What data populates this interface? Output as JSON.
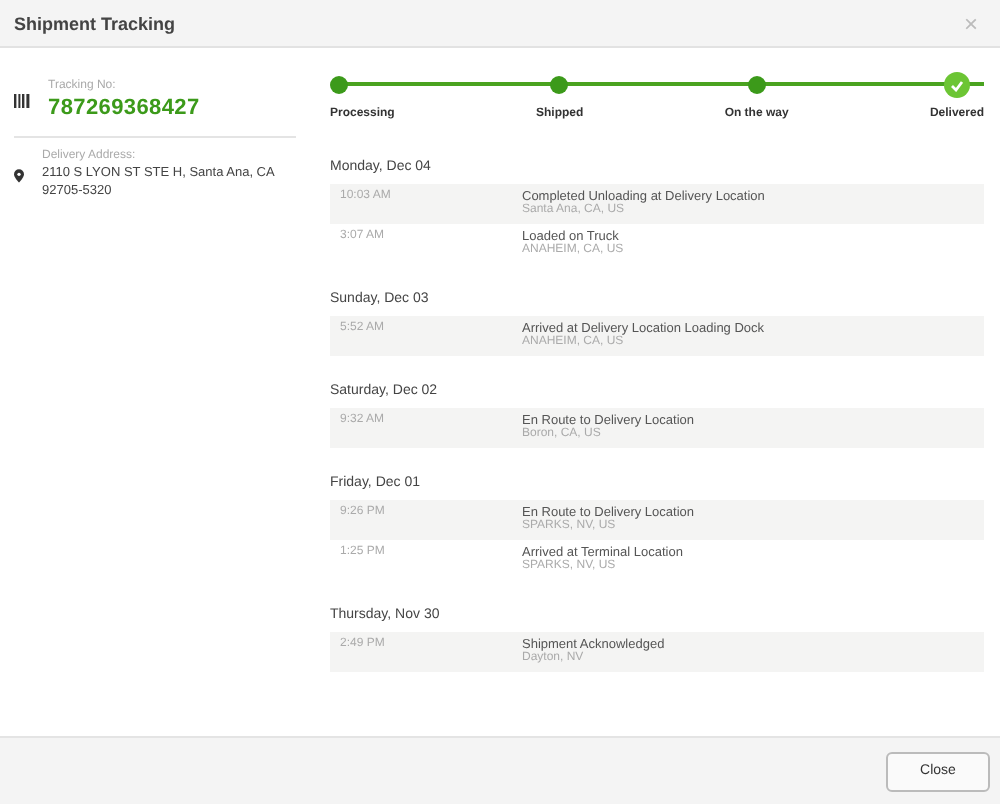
{
  "window": {
    "title": "Shipment Tracking",
    "close_glyph": "×"
  },
  "tracking": {
    "label": "Tracking No:",
    "number": "787269368427"
  },
  "delivery": {
    "label": "Delivery Address:",
    "address": "2110 S LYON ST STE H, Santa Ana, CA 92705-5320"
  },
  "steps": [
    {
      "label": "Processing",
      "done": true,
      "current": false
    },
    {
      "label": "Shipped",
      "done": true,
      "current": false
    },
    {
      "label": "On the way",
      "done": true,
      "current": false
    },
    {
      "label": "Delivered",
      "done": true,
      "current": true
    }
  ],
  "days": [
    {
      "date": "Monday, Dec 04",
      "events": [
        {
          "time": "10:03 AM",
          "title": "Completed Unloading at Delivery Location",
          "place": "Santa Ana, CA, US"
        },
        {
          "time": "3:07 AM",
          "title": "Loaded on Truck",
          "place": "ANAHEIM, CA, US"
        }
      ]
    },
    {
      "date": "Sunday, Dec 03",
      "events": [
        {
          "time": "5:52 AM",
          "title": "Arrived at Delivery Location Loading Dock",
          "place": "ANAHEIM, CA, US"
        }
      ]
    },
    {
      "date": "Saturday, Dec 02",
      "events": [
        {
          "time": "9:32 AM",
          "title": "En Route to Delivery Location",
          "place": "Boron, CA, US"
        }
      ]
    },
    {
      "date": "Friday, Dec 01",
      "events": [
        {
          "time": "9:26 PM",
          "title": "En Route to Delivery Location",
          "place": "SPARKS, NV, US"
        },
        {
          "time": "1:25 PM",
          "title": "Arrived at Terminal Location",
          "place": "SPARKS, NV, US"
        }
      ]
    },
    {
      "date": "Thursday, Nov 30",
      "events": [
        {
          "time": "2:49 PM",
          "title": "Shipment Acknowledged",
          "place": "Dayton, NV"
        }
      ]
    }
  ],
  "footer": {
    "button": "Close"
  }
}
